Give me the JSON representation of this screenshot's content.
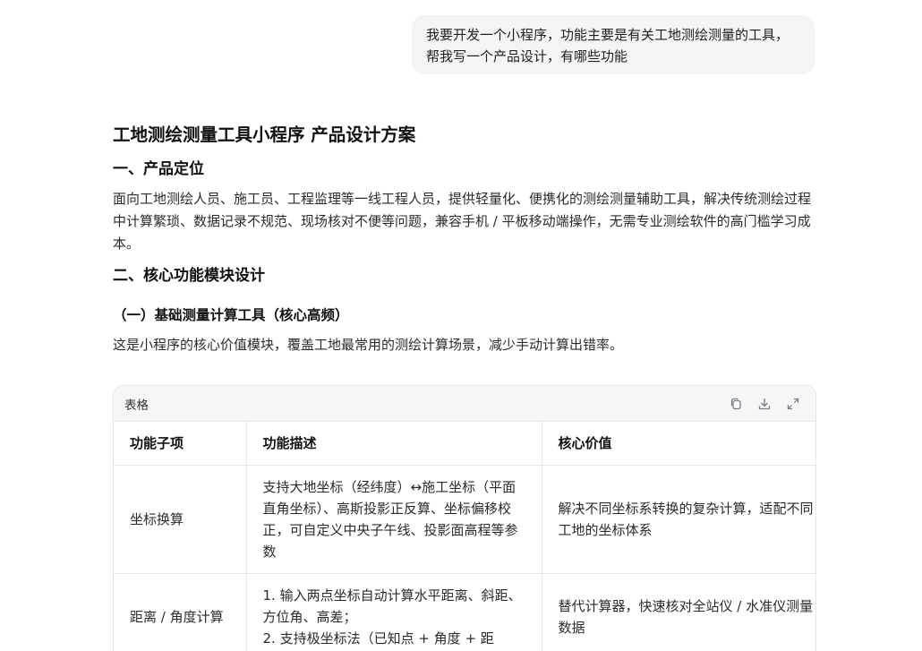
{
  "user_message": "我要开发一个小程序，功能主要是有关工地测绘测量的工具，帮我写一个产品设计，有哪些功能",
  "answer": {
    "title": "工地测绘测量工具小程序 产品设计方案",
    "section1_heading": "一、产品定位",
    "section1_text": "面向工地测绘人员、施工员、工程监理等一线工程人员，提供轻量化、便携化的测绘测量辅助工具，解决传统测绘过程中计算繁琐、数据记录不规范、现场核对不便等问题，兼容手机 / 平板移动端操作，无需专业测绘软件的高门槛学习成本。",
    "section2_heading": "二、核心功能模块设计",
    "subsection1_heading": "（一）基础测量计算工具（核心高频）",
    "subsection1_text": "这是小程序的核心价值模块，覆盖工地最常用的测绘计算场景，减少手动计算出错率。"
  },
  "table": {
    "label": "表格",
    "columns": [
      "功能子项",
      "功能描述",
      "核心价值"
    ],
    "rows": [
      {
        "item": "坐标换算",
        "desc": "支持大地坐标（经纬度）↔施工坐标（平面直角坐标）、高斯投影正反算、坐标偏移校正，可自定义中央子午线、投影面高程等参数",
        "value": "解决不同坐标系转换的复杂计算，适配不同工地的坐标体系"
      },
      {
        "item": "距离 / 角度计算",
        "desc": "1. 输入两点坐标自动计算水平距离、斜距、方位角、高差；\n2. 支持极坐标法（已知点 + 角度 + 距",
        "value": "替代计算器，快速核对全站仪 / 水准仪测量数据"
      }
    ]
  },
  "icons": {
    "copy": "copy-icon",
    "download": "download-icon",
    "expand": "expand-icon"
  }
}
